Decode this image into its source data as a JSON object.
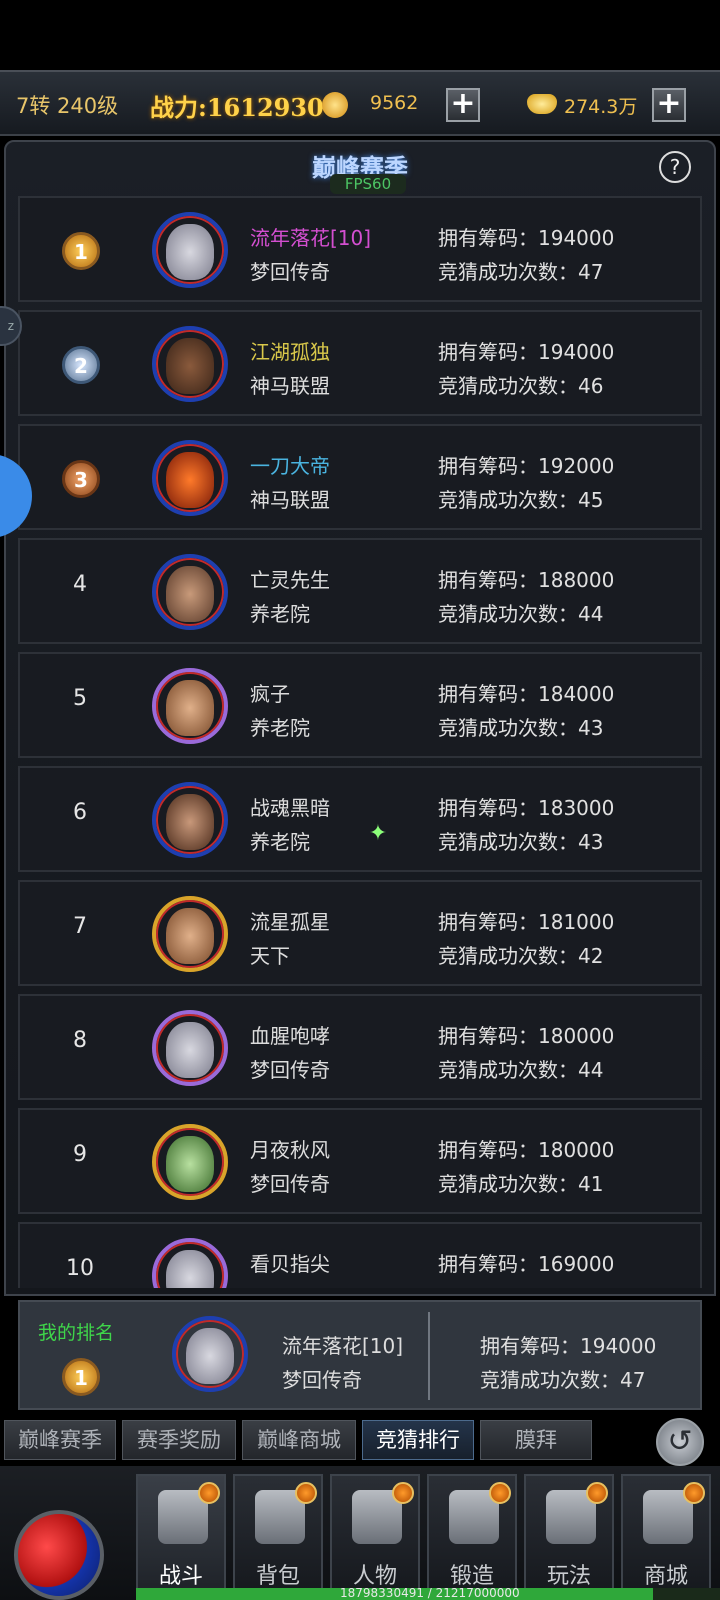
{
  "topbar": {
    "level": "7转 240级",
    "power": "战力:1612930",
    "coins": "9562",
    "gold": "274.3万",
    "plus": "+"
  },
  "panel": {
    "title": "巅峰赛季",
    "fps": "FPS60",
    "help": "?"
  },
  "ranking": [
    {
      "rank": "1",
      "name": "流年落花[10]",
      "guild": "梦回传奇",
      "chips": "拥有筹码：194000",
      "wins": "竞猜成功次数：47",
      "name_color": "#d44fd1"
    },
    {
      "rank": "2",
      "name": "江湖孤独",
      "guild": "神马联盟",
      "chips": "拥有筹码：194000",
      "wins": "竞猜成功次数：46",
      "name_color": "#d9c84a"
    },
    {
      "rank": "3",
      "name": "一刀大帝",
      "guild": "神马联盟",
      "chips": "拥有筹码：192000",
      "wins": "竞猜成功次数：45",
      "name_color": "#4ab4e0"
    },
    {
      "rank": "4",
      "name": "亡灵先生",
      "guild": "养老院",
      "chips": "拥有筹码：188000",
      "wins": "竞猜成功次数：44"
    },
    {
      "rank": "5",
      "name": "疯子",
      "guild": "养老院",
      "chips": "拥有筹码：184000",
      "wins": "竞猜成功次数：43"
    },
    {
      "rank": "6",
      "name": "战魂黑暗",
      "guild": "养老院",
      "chips": "拥有筹码：183000",
      "wins": "竞猜成功次数：43"
    },
    {
      "rank": "7",
      "name": "流星孤星",
      "guild": "天下",
      "chips": "拥有筹码：181000",
      "wins": "竞猜成功次数：42"
    },
    {
      "rank": "8",
      "name": "血腥咆哮",
      "guild": "梦回传奇",
      "chips": "拥有筹码：180000",
      "wins": "竞猜成功次数：44"
    },
    {
      "rank": "9",
      "name": "月夜秋风",
      "guild": "梦回传奇",
      "chips": "拥有筹码：180000",
      "wins": "竞猜成功次数：41"
    },
    {
      "rank": "10",
      "name": "看贝指尖",
      "guild": "",
      "chips": "拥有筹码：169000",
      "wins": ""
    }
  ],
  "my_rank": {
    "label": "我的排名",
    "rank": "1",
    "name": "流年落花[10]",
    "guild": "梦回传奇",
    "chips": "拥有筹码：194000",
    "wins": "竞猜成功次数：47"
  },
  "tabs": [
    "巅峰赛季",
    "赛季奖励",
    "巅峰商城",
    "竞猜排行",
    "膜拜"
  ],
  "active_tab": "竞猜排行",
  "back_icon": "↺",
  "nav": [
    "战斗",
    "背包",
    "人物",
    "锻造",
    "玩法",
    "商城"
  ],
  "xp_text": "18798330491 / 21217000000",
  "xp_fraction": 0.886,
  "sparkle": "✦"
}
